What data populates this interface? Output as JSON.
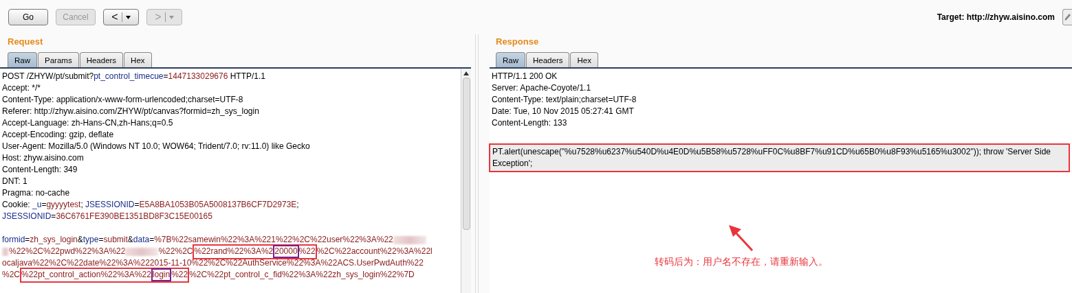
{
  "toolbar": {
    "buttons": [
      {
        "kind": "text",
        "label": "Go",
        "disabled": false
      },
      {
        "kind": "text",
        "label": "Cancel",
        "disabled": true
      },
      {
        "kind": "back",
        "label": "<",
        "disabled": false
      },
      {
        "kind": "forward",
        "label": ">",
        "disabled": true
      }
    ],
    "target": "Target: http://zhyw.aisino.com"
  },
  "request": {
    "title": "Request",
    "tabs": [
      {
        "label": "Raw",
        "selected": true
      },
      {
        "label": "Params",
        "selected": false
      },
      {
        "label": "Headers",
        "selected": false
      },
      {
        "label": "Hex",
        "selected": false
      }
    ],
    "lines": [
      [
        {
          "kind": "plain",
          "text": "POST /ZHYW/pt/submit?"
        },
        {
          "kind": "name",
          "text": "pt_control_timecue"
        },
        {
          "kind": "plain",
          "text": "="
        },
        {
          "kind": "value",
          "text": "1447133029676"
        },
        {
          "kind": "plain",
          "text": " HTTP/1.1"
        }
      ],
      [
        {
          "kind": "plain",
          "text": "Accept: */*"
        }
      ],
      [
        {
          "kind": "plain",
          "text": "Content-Type: application/x-www-form-urlencoded;charset=UTF-8"
        }
      ],
      [
        {
          "kind": "plain",
          "text": "Referer: http://zhyw.aisino.com/ZHYW/pt/canvas?formid=zh_sys_login"
        }
      ],
      [
        {
          "kind": "plain",
          "text": "Accept-Language: zh-Hans-CN,zh-Hans;q=0.5"
        }
      ],
      [
        {
          "kind": "plain",
          "text": "Accept-Encoding: gzip, deflate"
        }
      ],
      [
        {
          "kind": "plain",
          "text": "User-Agent: Mozilla/5.0 (Windows NT 10.0; WOW64; Trident/7.0; rv:11.0) like Gecko"
        }
      ],
      [
        {
          "kind": "plain",
          "text": "Host: zhyw.aisino.com"
        }
      ],
      [
        {
          "kind": "plain",
          "text": "Content-Length: 349"
        }
      ],
      [
        {
          "kind": "plain",
          "text": "DNT: 1"
        }
      ],
      [
        {
          "kind": "plain",
          "text": "Pragma: no-cache"
        }
      ],
      [
        {
          "kind": "plain",
          "text": "Cookie: "
        },
        {
          "kind": "name",
          "text": "_u"
        },
        {
          "kind": "plain",
          "text": "="
        },
        {
          "kind": "value",
          "text": "gyyyytest"
        },
        {
          "kind": "plain",
          "text": "; "
        },
        {
          "kind": "name",
          "text": "JSESSIONID"
        },
        {
          "kind": "plain",
          "text": "="
        },
        {
          "kind": "value",
          "text": "E5A8BA1053B05A5008137B6CF7D2973E"
        },
        {
          "kind": "plain",
          "text": ";"
        }
      ],
      [
        {
          "kind": "name",
          "text": "JSESSIONID"
        },
        {
          "kind": "plain",
          "text": "="
        },
        {
          "kind": "value",
          "text": "36C6761FE390BE1351BD8F3C15E00165"
        }
      ]
    ],
    "body_lines": [
      [
        {
          "kind": "name",
          "text": "formid"
        },
        {
          "kind": "plain",
          "text": "="
        },
        {
          "kind": "value",
          "text": "zh_sys_login"
        },
        {
          "kind": "plain",
          "text": "&"
        },
        {
          "kind": "name",
          "text": "type"
        },
        {
          "kind": "plain",
          "text": "="
        },
        {
          "kind": "value",
          "text": "submit"
        },
        {
          "kind": "plain",
          "text": "&"
        },
        {
          "kind": "name",
          "text": "data"
        },
        {
          "kind": "plain",
          "text": "="
        },
        {
          "kind": "value",
          "text": "%7B%22samewin%22%3A%221%22%2C%22user%22%3A%22"
        },
        {
          "kind": "redacted"
        }
      ],
      [
        {
          "kind": "redacted"
        },
        {
          "kind": "value",
          "text": "%22%2C%22pwd%22%3A%22"
        },
        {
          "kind": "redacted"
        },
        {
          "kind": "value",
          "text": "%22%2C"
        },
        {
          "kind": "box",
          "color": "#e8353d",
          "parts": [
            {
              "kind": "value",
              "text": "%22rand%22%3A%2"
            },
            {
              "kind": "box",
              "color": "#7a1f8f",
              "parts": [
                {
                  "kind": "value",
                  "text": "20000"
                }
              ]
            },
            {
              "kind": "value",
              "text": "%22"
            }
          ]
        },
        {
          "kind": "value",
          "text": "%2C%22account%22%3A%22l"
        }
      ],
      [
        {
          "kind": "value",
          "text": "ocaljava%22%2C%22date%22%3A%222015-11-10%22%2C%22AuthService%22%3A%22ACS.UserPwdAuth%22"
        }
      ],
      [
        {
          "kind": "value",
          "text": "%2C"
        },
        {
          "kind": "box",
          "color": "#e8353d",
          "parts": [
            {
              "kind": "value",
              "text": "%22pt_control_action%22%3A%22"
            },
            {
              "kind": "box",
              "color": "#7a1f8f",
              "parts": [
                {
                  "kind": "value",
                  "text": "login"
                }
              ]
            },
            {
              "kind": "value",
              "text": "%22"
            }
          ]
        },
        {
          "kind": "value",
          "text": "%2C%22pt_control_c_fid%22%3A%22zh_sys_login%22%7D"
        }
      ]
    ]
  },
  "response": {
    "title": "Response",
    "tabs": [
      {
        "label": "Raw",
        "selected": true
      },
      {
        "label": "Headers",
        "selected": false
      },
      {
        "label": "Hex",
        "selected": false
      }
    ],
    "headers": [
      "HTTP/1.1 200 OK",
      "Server: Apache-Coyote/1.1",
      "Content-Type: text/plain;charset=UTF-8",
      "Date: Tue, 10 Nov 2015 05:27:41 GMT",
      "Content-Length: 133"
    ],
    "body": "PT.alert(unescape(\"%u7528%u6237%u540D%u4E0D%u5B58%u5728%uFF0C%u8BF7%u91CD%u65B0%u8F93%u5165%u3002\")); throw 'Server Side Exception';",
    "annotation": "转码后为：用户名不存在，请重新输入。"
  }
}
